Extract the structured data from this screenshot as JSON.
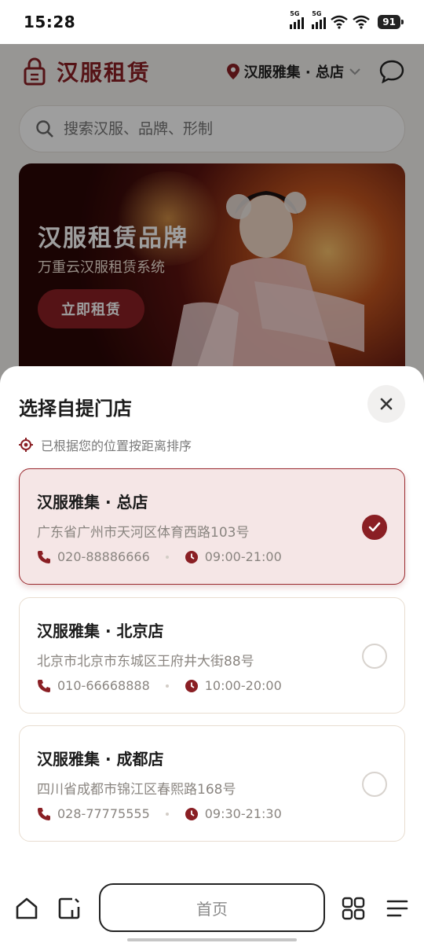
{
  "status_bar": {
    "time": "15:28",
    "sim1": "5G",
    "sim2": "5G",
    "battery": "91"
  },
  "header": {
    "brand": "汉服租赁",
    "location": "汉服雅集 · 总店"
  },
  "search": {
    "placeholder": "搜索汉服、品牌、形制"
  },
  "banner": {
    "title": "汉服租赁品牌",
    "subtitle": "万重云汉服租赁系统",
    "cta": "立即租赁"
  },
  "sheet": {
    "title": "选择自提门店",
    "hint": "已根据您的位置按距离排序",
    "stores": [
      {
        "name": "汉服雅集 · 总店",
        "address": "广东省广州市天河区体育西路103号",
        "phone": "020-88886666",
        "hours": "09:00-21:00",
        "selected": true
      },
      {
        "name": "汉服雅集 · 北京店",
        "address": "北京市北京市东城区王府井大街88号",
        "phone": "010-66668888",
        "hours": "10:00-20:00",
        "selected": false
      },
      {
        "name": "汉服雅集 · 成都店",
        "address": "四川省成都市锦江区春熙路168号",
        "phone": "028-77775555",
        "hours": "09:30-21:30",
        "selected": false
      }
    ]
  },
  "bottom_nav": {
    "home_label": "首页"
  },
  "colors": {
    "accent": "#8a1f24",
    "selected_bg": "#f5e6e6"
  }
}
